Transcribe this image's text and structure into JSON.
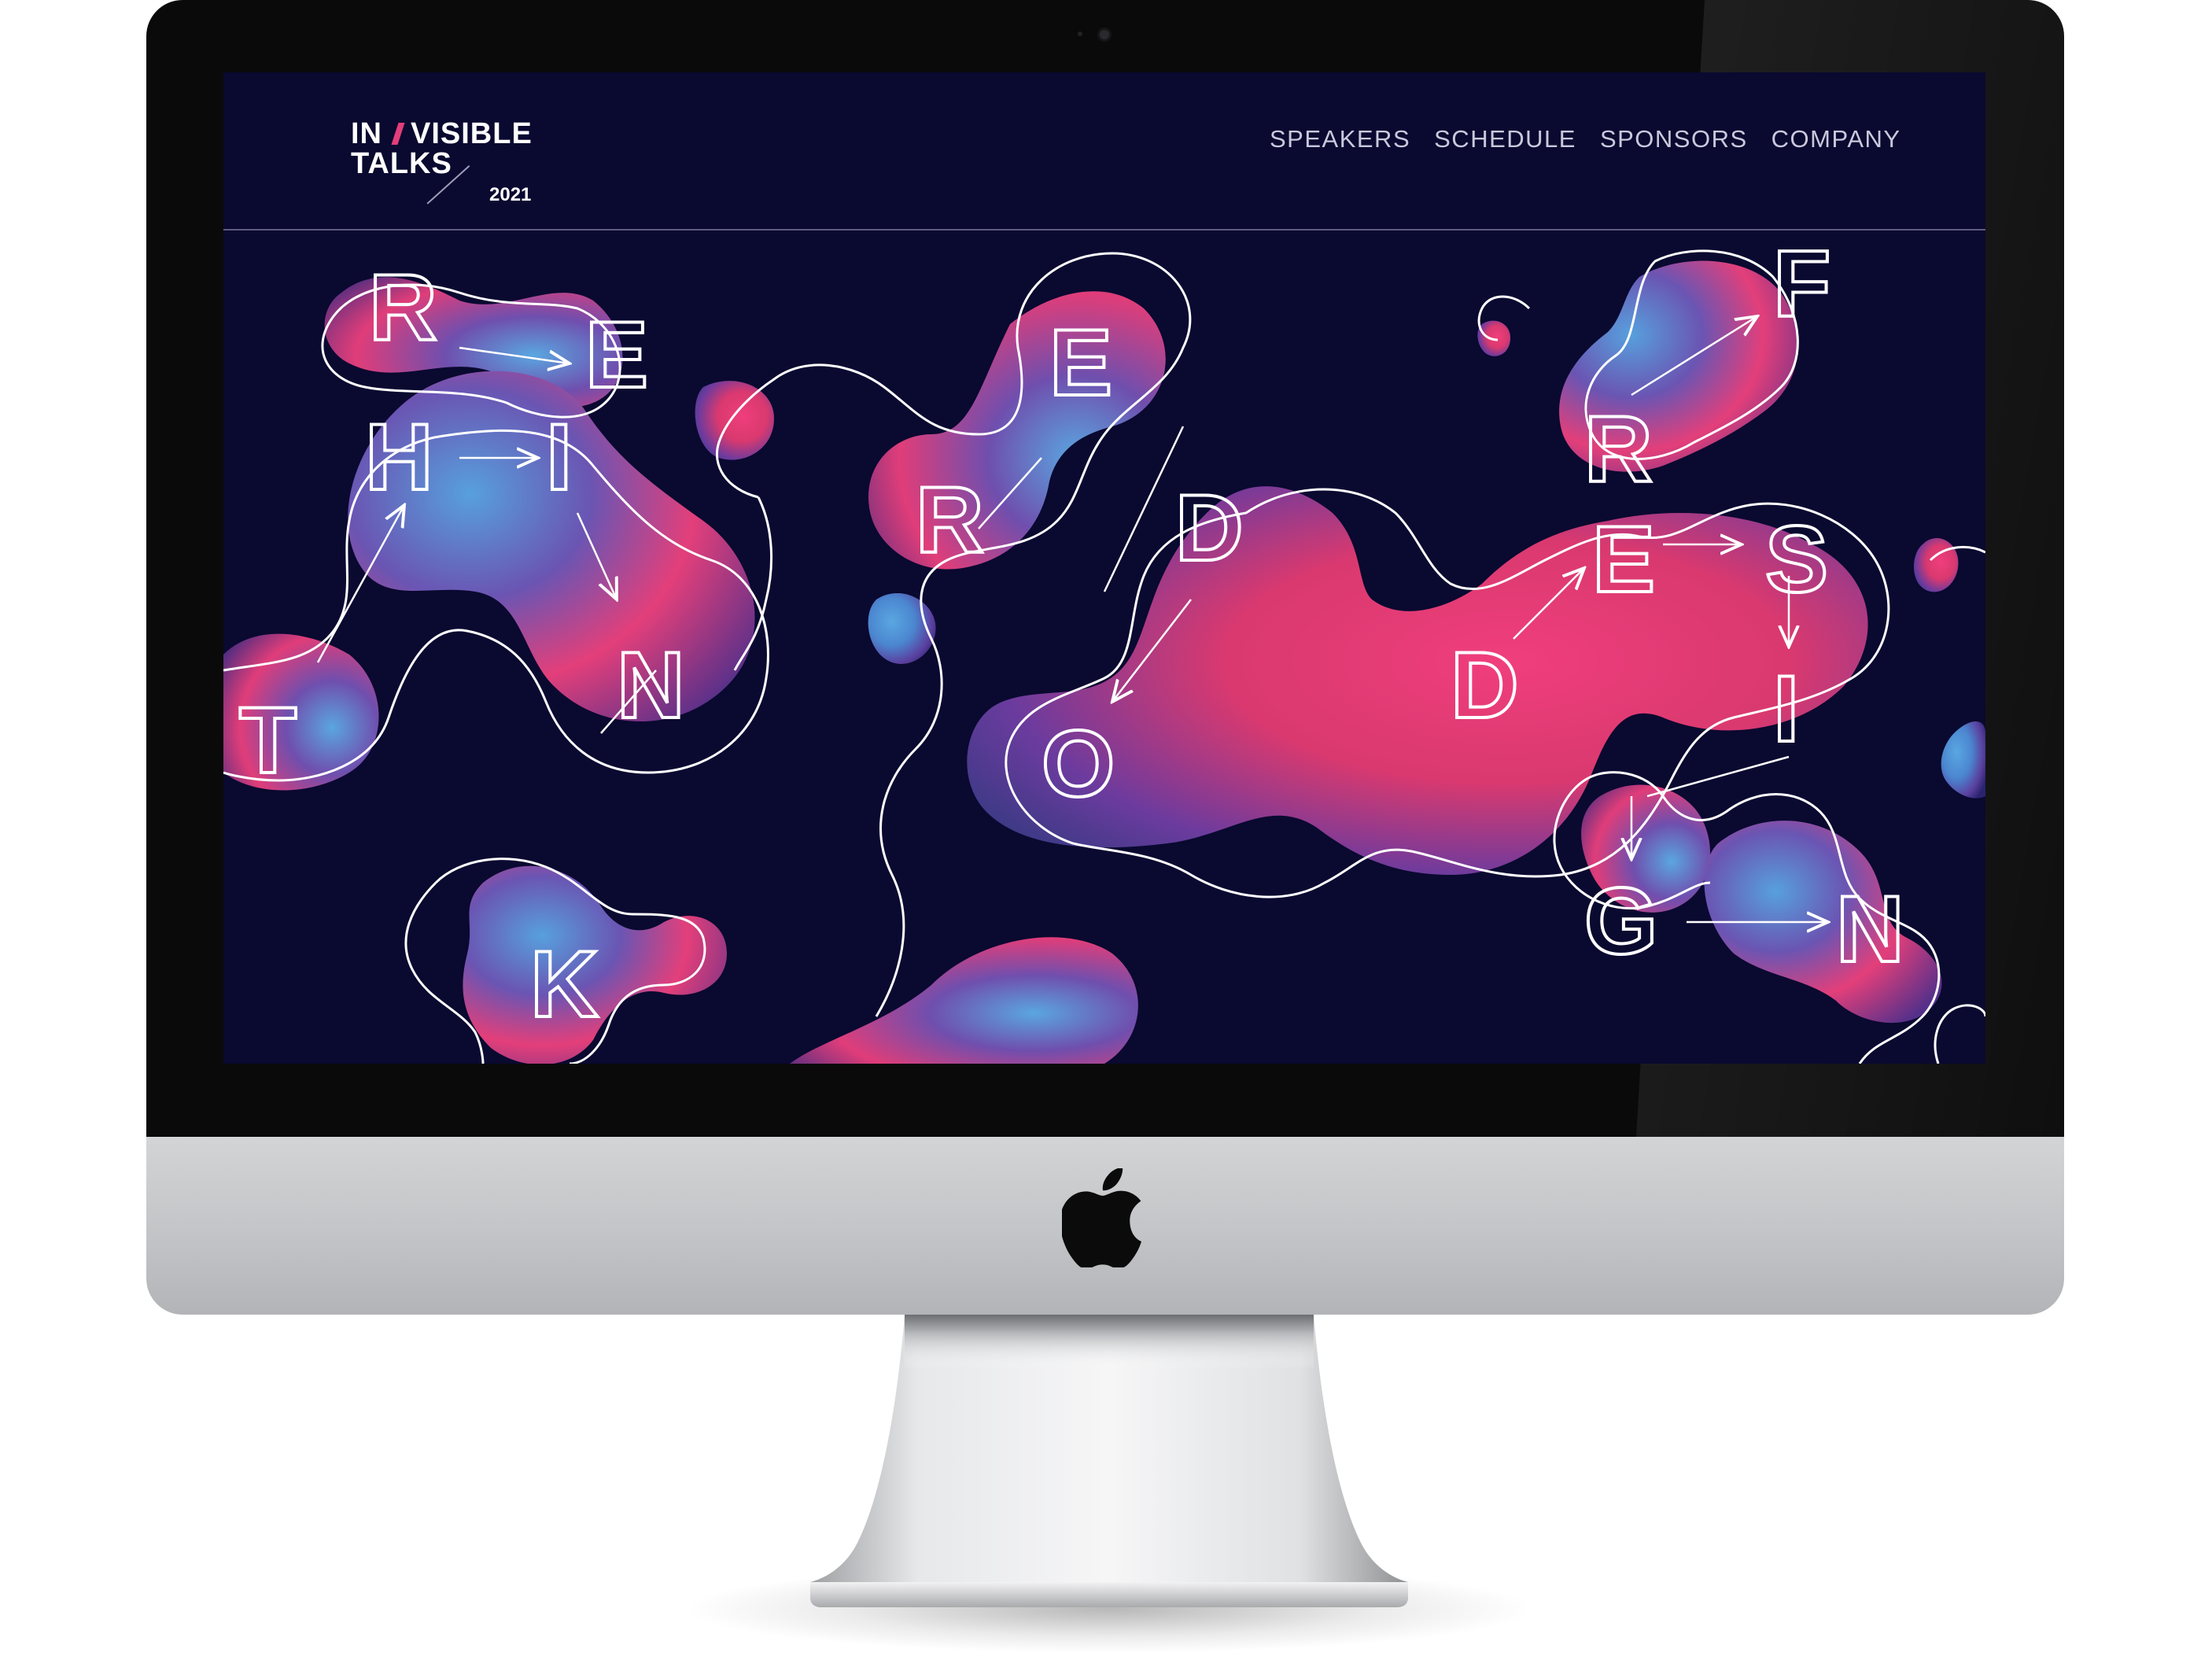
{
  "site": {
    "logo": {
      "line1_a": "IN",
      "line1_b": "VISIBLE",
      "line2": "TALKS",
      "year": "2021"
    },
    "nav": [
      {
        "label": "SPEAKERS"
      },
      {
        "label": "SCHEDULE"
      },
      {
        "label": "SPONSORS"
      },
      {
        "label": "COMPANY"
      }
    ],
    "hero_letters": [
      "R",
      "E",
      "E",
      "R",
      "F",
      "H",
      "I",
      "R",
      "D",
      "E",
      "S",
      "T",
      "N",
      "D",
      "O",
      "G",
      "K",
      "I",
      "N"
    ],
    "colors": {
      "background": "#0a0930",
      "accent_pink": "#e23e7b",
      "accent_blue": "#4f9fdc",
      "accent_purple": "#5a3f9e",
      "nav_text": "#c9c9dc",
      "outline": "#ffffff"
    }
  },
  "device": {
    "logo_icon": "apple-logo-icon",
    "colors": {
      "bezel": "#0a0a0b",
      "chin": "#c6c7ca"
    }
  }
}
